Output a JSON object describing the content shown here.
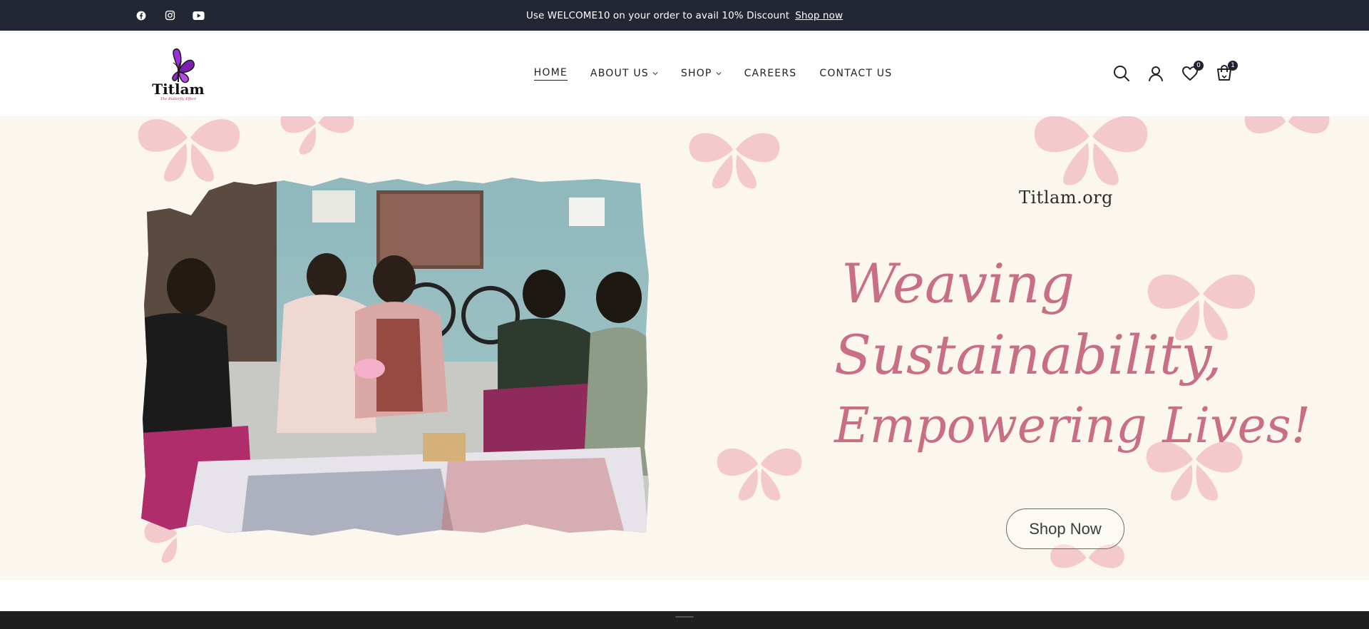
{
  "announcement": {
    "text": "Use WELCOME10 on your order to avail 10% Discount",
    "link_label": "Shop now"
  },
  "social": [
    {
      "name": "facebook-icon"
    },
    {
      "name": "instagram-icon"
    },
    {
      "name": "youtube-icon"
    }
  ],
  "logo": {
    "text": "Titlam",
    "tagline": "The Butterfly Effect",
    "color": "#9b2fd6"
  },
  "nav": {
    "items": [
      {
        "label": "HOME",
        "active": true,
        "dropdown": false
      },
      {
        "label": "ABOUT US",
        "active": false,
        "dropdown": true
      },
      {
        "label": "SHOP",
        "active": false,
        "dropdown": true
      },
      {
        "label": "CAREERS",
        "active": false,
        "dropdown": false
      },
      {
        "label": "CONTACT US",
        "active": false,
        "dropdown": false
      }
    ]
  },
  "header_icons": {
    "wishlist_count": "0",
    "cart_count": "1"
  },
  "hero": {
    "brand": "Titlam.org",
    "headline": [
      "Weaving",
      "Sustainability,",
      "Empowering Lives!"
    ],
    "cta_label": "Shop Now",
    "headline_color": "#c86f86",
    "background": "#fbf7ee",
    "butterfly_color": "#f4c9cd"
  }
}
